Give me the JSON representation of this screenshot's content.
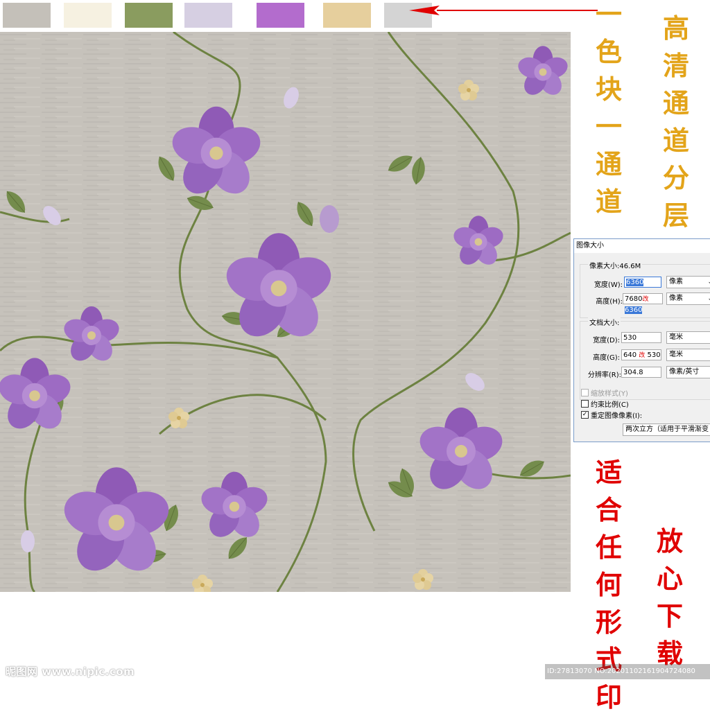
{
  "swatches": {
    "colors": [
      "#c4c0b9",
      "#f6f1e1",
      "#8a9c5f",
      "#d6cfe2",
      "#b36ccd",
      "#e6cf9d",
      "#d4d4d4"
    ]
  },
  "colors": {
    "arrow": "#e00000",
    "yellow_text": "#e3a41a",
    "red_text": "#e00000",
    "background_pattern": "#c6c2bb",
    "flower_purple": "#9a67c0",
    "leaf_green": "#748c4c"
  },
  "side_text": {
    "col_color_channel": "一\n色\n块\n一\n通\n道",
    "col_hd_layers": "高\n清\n通\n道\n分\n层",
    "col_any_print": "适\n合\n任\n何\n形\n式\n印",
    "col_download": "放\n心\n下\n载"
  },
  "dialog": {
    "title": "图像大小",
    "pixel_dimensions": "像素大小:46.6M",
    "width_label": "宽度(W):",
    "width_value": "6360",
    "width_unit": "像素",
    "height_label": "高度(H):",
    "height_value_old": "7680",
    "height_change_mark": "改",
    "height_value": "6360",
    "height_unit": "像素",
    "doc_size_label": "文档大小:",
    "doc_width_label": "宽度(D):",
    "doc_width_value": "530",
    "doc_width_unit": "毫米",
    "doc_height_label": "高度(G):",
    "doc_height_old": "640",
    "doc_height_mark": "改",
    "doc_height_value": "530",
    "doc_height_unit": "毫米",
    "resolution_label": "分辨率(R):",
    "resolution_value": "304.8",
    "resolution_unit": "像素/英寸",
    "scale_styles": "缩放样式(Y)",
    "constrain_proportions": "约束比例(C)",
    "resample_image": "重定图像像素(I):",
    "resample_method": "两次立方（适用于平滑渐变"
  },
  "watermark": {
    "site": "昵图网 www.nipic.com",
    "id_text": "ID:27813070 NO:20201102161904724080"
  }
}
